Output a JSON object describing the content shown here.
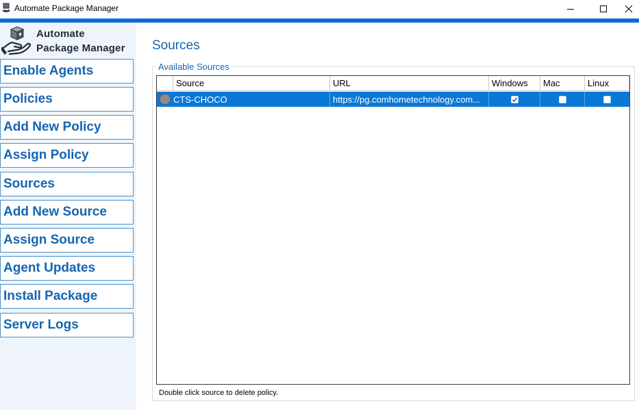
{
  "window": {
    "title": "Automate Package Manager"
  },
  "colors": {
    "accent": "#1565b0",
    "strip": "#0a6cd6",
    "selected_row": "#0a78d7",
    "sidebar_bg": "#eef4fa"
  },
  "brand": {
    "line1": "Automate",
    "line2": "Package Manager"
  },
  "sidebar": {
    "items": [
      {
        "label": "Enable Agents"
      },
      {
        "label": "Policies"
      },
      {
        "label": "Add New Policy"
      },
      {
        "label": "Assign Policy"
      },
      {
        "label": "Sources"
      },
      {
        "label": "Add New Source"
      },
      {
        "label": "Assign Source"
      },
      {
        "label": "Agent Updates"
      },
      {
        "label": "Install Package"
      },
      {
        "label": "Server Logs"
      }
    ]
  },
  "main": {
    "title": "Sources",
    "group_label": "Available Sources",
    "columns": {
      "source": "Source",
      "url": "URL",
      "windows": "Windows",
      "mac": "Mac",
      "linux": "Linux"
    },
    "rows": [
      {
        "source": "CTS-CHOCO",
        "url": "https://pg.comhometechnology.com...",
        "windows": true,
        "mac": false,
        "linux": false
      }
    ],
    "status_text": "Double click source to delete policy."
  }
}
